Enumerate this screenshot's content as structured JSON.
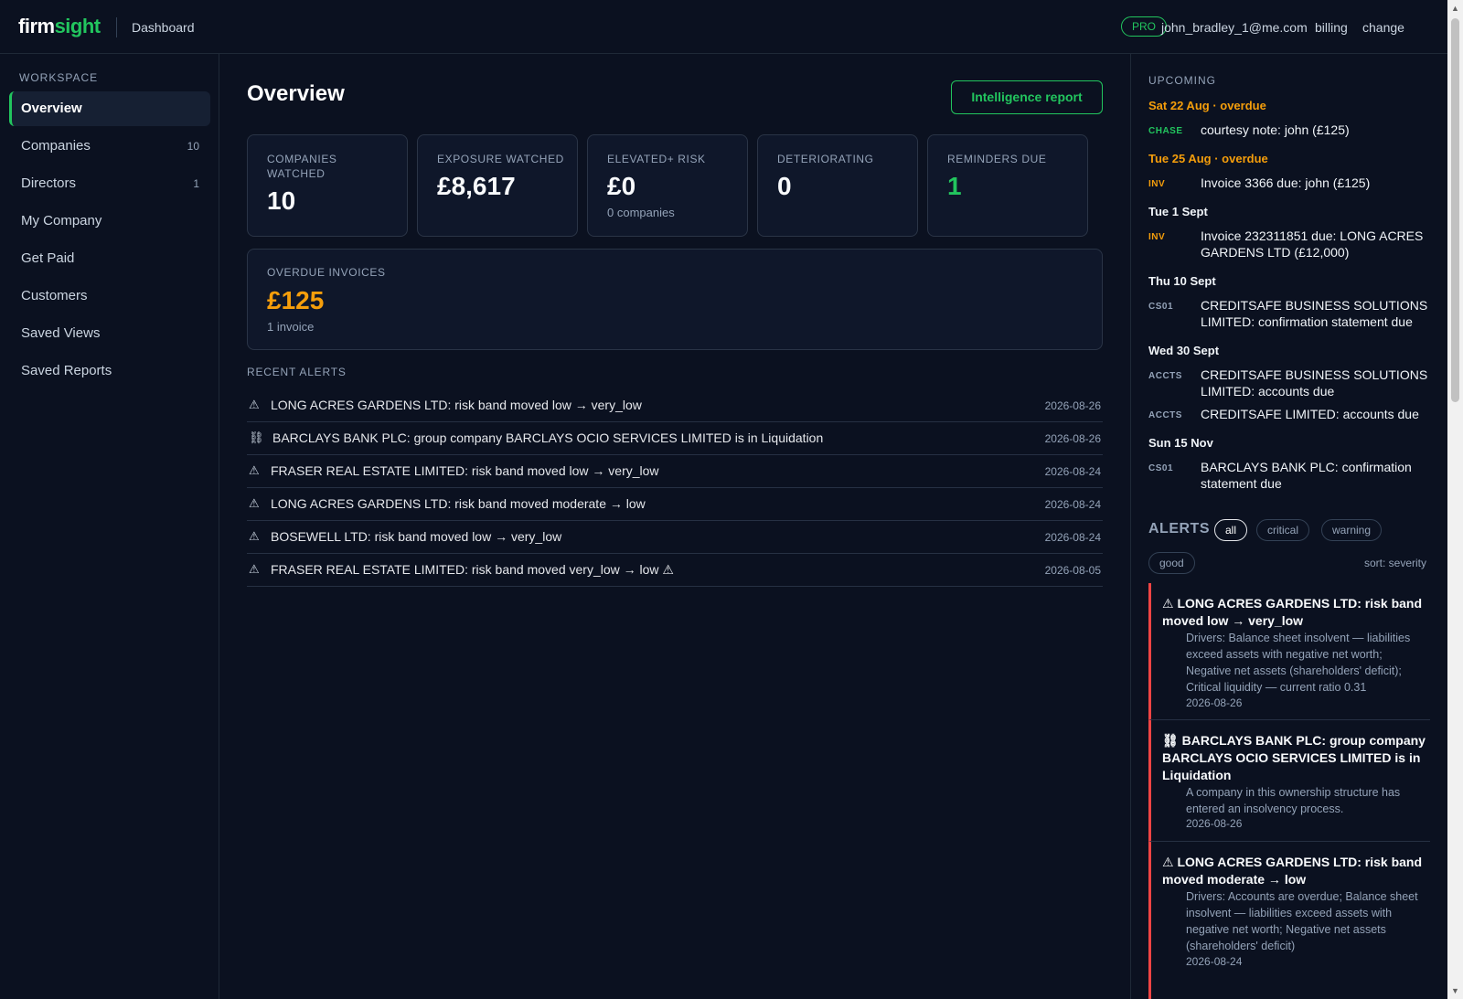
{
  "brand": {
    "part1": "firm",
    "part2": "sight"
  },
  "topbar": {
    "section": "Dashboard",
    "plan": "PRO",
    "email": "john_bradley_1@me.com",
    "billing": "billing",
    "change": "change"
  },
  "sidebar": {
    "heading": "WORKSPACE",
    "items": [
      {
        "label": "Overview",
        "count": ""
      },
      {
        "label": "Companies",
        "count": "10"
      },
      {
        "label": "Directors",
        "count": "1"
      },
      {
        "label": "My Company",
        "count": ""
      },
      {
        "label": "Get Paid",
        "count": ""
      },
      {
        "label": "Customers",
        "count": ""
      },
      {
        "label": "Saved Views",
        "count": ""
      },
      {
        "label": "Saved Reports",
        "count": ""
      }
    ]
  },
  "main": {
    "title": "Overview",
    "report_button": "Intelligence report",
    "stats": [
      {
        "label": "COMPANIES WATCHED",
        "value": "10",
        "sub": ""
      },
      {
        "label": "EXPOSURE WATCHED",
        "value": "£8,617",
        "sub": ""
      },
      {
        "label": "ELEVATED+ RISK",
        "value": "£0",
        "sub": "0 companies"
      },
      {
        "label": "DETERIORATING",
        "value": "0",
        "sub": ""
      },
      {
        "label": "REMINDERS DUE",
        "value": "1",
        "sub": ""
      }
    ],
    "overdue": {
      "label": "OVERDUE INVOICES",
      "value": "£125",
      "sub": "1 invoice"
    },
    "recent_alerts_heading": "RECENT ALERTS",
    "recent_alerts": [
      {
        "icon": "⚠",
        "text": "LONG ACRES GARDENS LTD: risk band moved low → very_low",
        "date": "2026-08-26"
      },
      {
        "icon": "⛓",
        "text": "BARCLAYS BANK PLC: group company BARCLAYS OCIO SERVICES LIMITED is in Liquidation",
        "date": "2026-08-26"
      },
      {
        "icon": "⚠",
        "text": "FRASER REAL ESTATE LIMITED: risk band moved low → very_low",
        "date": "2026-08-24"
      },
      {
        "icon": "⚠",
        "text": "LONG ACRES GARDENS LTD: risk band moved moderate → low",
        "date": "2026-08-24"
      },
      {
        "icon": "⚠",
        "text": "BOSEWELL LTD: risk band moved low → very_low",
        "date": "2026-08-24"
      },
      {
        "icon": "⚠",
        "text": "FRASER REAL ESTATE LIMITED: risk band moved very_low → low ⚠",
        "date": "2026-08-05"
      }
    ]
  },
  "upcoming": {
    "heading": "UPCOMING",
    "days": [
      {
        "day": "Sat 22 Aug · overdue",
        "events": [
          {
            "tag": "CHASE",
            "text": "courtesy note: john (£125)"
          }
        ]
      },
      {
        "day": "Tue 25 Aug · overdue",
        "events": [
          {
            "tag": "INV",
            "text": "Invoice 3366 due: john (£125)"
          }
        ]
      },
      {
        "day": "Tue 1 Sept",
        "events": [
          {
            "tag": "INV",
            "text": "Invoice 232311851 due: LONG ACRES GARDENS LTD (£12,000)"
          }
        ]
      },
      {
        "day": "Thu 10 Sept",
        "events": [
          {
            "tag": "CS01",
            "text": "CREDITSAFE BUSINESS SOLUTIONS LIMITED: confirmation statement due"
          }
        ]
      },
      {
        "day": "Wed 30 Sept",
        "events": [
          {
            "tag": "ACCTS",
            "text": "CREDITSAFE BUSINESS SOLUTIONS LIMITED: accounts due"
          },
          {
            "tag": "ACCTS",
            "text": "CREDITSAFE LIMITED: accounts due"
          }
        ]
      },
      {
        "day": "Sun 15 Nov",
        "events": [
          {
            "tag": "CS01",
            "text": "BARCLAYS BANK PLC: confirmation statement due"
          }
        ]
      }
    ]
  },
  "alerts_panel": {
    "heading": "ALERTS",
    "filters": [
      "all",
      "critical",
      "warning",
      "good"
    ],
    "sort": "sort: severity",
    "cards": [
      {
        "icon": "⚠",
        "title": "LONG ACRES GARDENS LTD: risk band moved low → very_low",
        "desc": "Drivers: Balance sheet insolvent — liabilities exceed assets with negative net worth; Negative net assets (shareholders' deficit); Critical liquidity — current ratio 0.31",
        "date": "2026-08-26"
      },
      {
        "icon": "⛓",
        "title": "BARCLAYS BANK PLC: group company BARCLAYS OCIO SERVICES LIMITED is in Liquidation",
        "desc": "A company in this ownership structure has entered an insolvency process.",
        "date": "2026-08-26"
      },
      {
        "icon": "⚠",
        "title": "LONG ACRES GARDENS LTD: risk band moved moderate → low",
        "desc": "Drivers: Accounts are overdue; Balance sheet insolvent — liabilities exceed assets with negative net worth; Negative net assets (shareholders' deficit)",
        "date": "2026-08-24"
      }
    ]
  },
  "colors": {
    "accent": "#22c55e",
    "warning": "#f59e0b",
    "critical": "#ef4444",
    "background": "#0b1120"
  }
}
